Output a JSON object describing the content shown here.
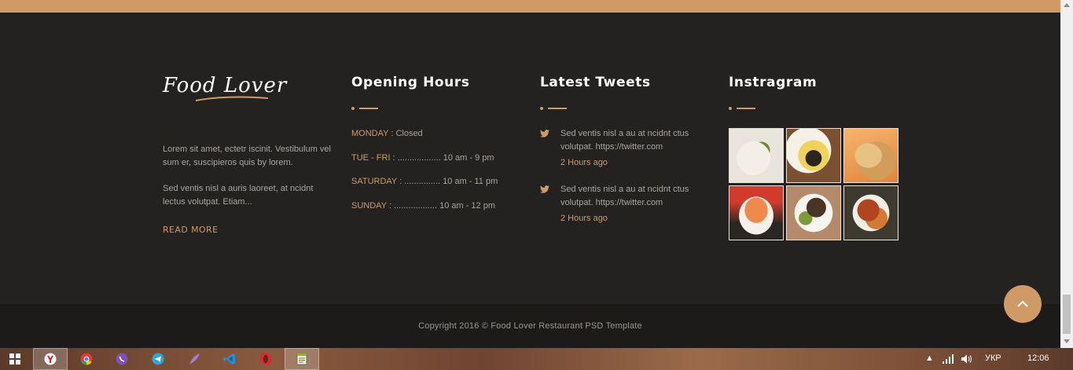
{
  "about": {
    "logo_text": "Food Lover",
    "paragraph1": "Lorem sit amet, ectetr iscinit. Vestibulum vel sum er, suscipieros quis by lorem.",
    "paragraph2": "Sed ventis nisl a auris laoreet, at ncidnt lectus volutpat. Etiam...",
    "read_more": "READ MORE"
  },
  "hours": {
    "title": "Opening Hours",
    "items": [
      {
        "day": "MONDAY",
        "sep": " : ",
        "time": "Closed"
      },
      {
        "day": "TUE - FRI",
        "sep": " : .................. ",
        "time": "10 am - 9 pm"
      },
      {
        "day": "SATURDAY",
        "sep": " : ............... ",
        "time": "10 am - 11 pm"
      },
      {
        "day": "SUNDAY",
        "sep": " : .................. ",
        "time": "10 am - 12 pm"
      }
    ]
  },
  "tweets": {
    "title": "Latest Tweets",
    "items": [
      {
        "text": "Sed ventis nisl a au at ncidnt ctus volutpat. https://twitter.com",
        "time": "2 Hours ago"
      },
      {
        "text": "Sed ventis nisl a au at ncidnt ctus volutpat. https://twitter.com",
        "time": "2 Hours ago"
      }
    ]
  },
  "instagram": {
    "title": "Instragram",
    "photos": [
      "salad-icon",
      "rice-plate-icon",
      "grilled-chicken-icon",
      "sushi-icon",
      "meat-dish-icon",
      "chicken-wings-icon"
    ]
  },
  "footer": {
    "copyright": "Copyright 2016 © Food Lover Restaurant PSD Template"
  },
  "taskbar": {
    "apps": [
      "yandex-browser-icon",
      "chrome-icon",
      "viber-icon",
      "telegram-icon",
      "feather-app-icon",
      "vscode-icon",
      "opera-icon",
      "notepad-icon"
    ],
    "language": "УКР",
    "clock": "12:06"
  },
  "colors": {
    "accent": "#cf9a66",
    "footer_bg": "#232221",
    "bottom_bg": "#1c1b1a"
  }
}
